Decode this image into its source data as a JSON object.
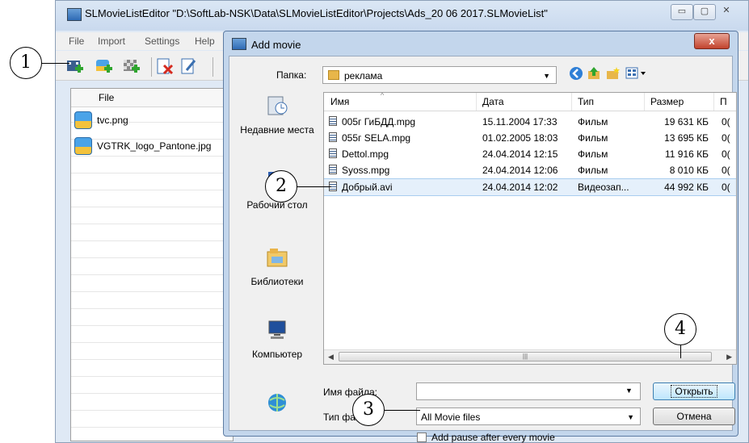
{
  "main_window": {
    "title": "SLMovieListEditor \"D:\\SoftLab-NSK\\Data\\SLMovieListEditor\\Projects\\Ads_20 06 2017.SLMovieList\"",
    "caption_buttons": [
      "▭",
      "▢",
      "✕"
    ],
    "menu": [
      "File",
      "Import",
      "Settings",
      "Help"
    ],
    "toolbar_icons": [
      "add-movie-icon",
      "add-image-icon",
      "add-pause-icon",
      "delete-icon",
      "edit-icon"
    ],
    "list_header": "File",
    "files": [
      "tvc.png",
      "VGTRK_logo_Pantone.jpg"
    ]
  },
  "dialog": {
    "title": "Add movie",
    "close_label": "x",
    "folder_label": "Папка:",
    "folder_value": "реклама",
    "places": [
      "Недавние места",
      "Рабочий стол",
      "Библиотеки",
      "Компьютер",
      "Сеть"
    ],
    "columns": [
      "Имя",
      "Дата",
      "Тип",
      "Размер",
      "П"
    ],
    "files": [
      {
        "name": "005г ГиБДД.mpg",
        "date": "15.11.2004 17:33",
        "type": "Фильм",
        "size": "19 631 КБ",
        "extra": "0("
      },
      {
        "name": "055г SELA.mpg",
        "date": "01.02.2005 18:03",
        "type": "Фильм",
        "size": "13 695 КБ",
        "extra": "0("
      },
      {
        "name": "Dettol.mpg",
        "date": "24.04.2014 12:15",
        "type": "Фильм",
        "size": "11 916 КБ",
        "extra": "0("
      },
      {
        "name": "Syoss.mpg",
        "date": "24.04.2014 12:06",
        "type": "Фильм",
        "size": "8 010 КБ",
        "extra": "0("
      },
      {
        "name": "Добрый.avi",
        "date": "24.04.2014 12:02",
        "type": "Видеозап...",
        "size": "44 992 КБ",
        "extra": "0("
      }
    ],
    "selected_index": 4,
    "filename_label": "Имя файла:",
    "filename_value": "",
    "filetype_label": "Тип файлов:",
    "filetype_value": "All Movie files",
    "open_label": "Открыть",
    "cancel_label": "Отмена",
    "pause_label": "Add pause after every movie",
    "pause_checked": false
  },
  "callouts": [
    "1",
    "2",
    "3",
    "4"
  ]
}
